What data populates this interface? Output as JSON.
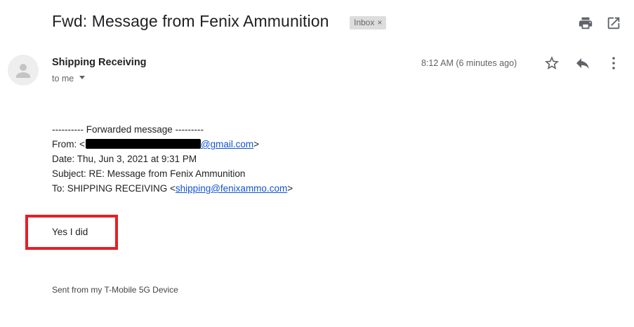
{
  "header": {
    "subject": "Fwd: Message from Fenix Ammunition",
    "label": "Inbox",
    "label_remove": "×",
    "icons": [
      "print-icon",
      "open-in-new-window-icon"
    ]
  },
  "message": {
    "sender_name": "Shipping Receiving",
    "recipient_summary": "to me",
    "timestamp": "8:12 AM (6 minutes ago)",
    "actions": [
      "star-icon",
      "reply-icon",
      "more-options-icon"
    ]
  },
  "forwarded": {
    "divider": "---------- Forwarded message ---------",
    "from_label": "From: <",
    "from_email_visible": "@gmail.com",
    "from_suffix": ">",
    "date_line": "Date: Thu, Jun 3, 2021 at 9:31 PM",
    "subject_line": "Subject: RE: Message from Fenix Ammunition",
    "to_label": "To: SHIPPING RECEIVING <",
    "to_email": "shipping@fenixammo.com",
    "to_suffix": ">"
  },
  "reply": {
    "text": "Yes I did",
    "highlight_color": "#e32025"
  },
  "signature": "Sent from my T-Mobile 5G Device",
  "colors": {
    "link": "#1155cc",
    "muted": "#5f6368",
    "chip_bg": "#dddddd"
  }
}
